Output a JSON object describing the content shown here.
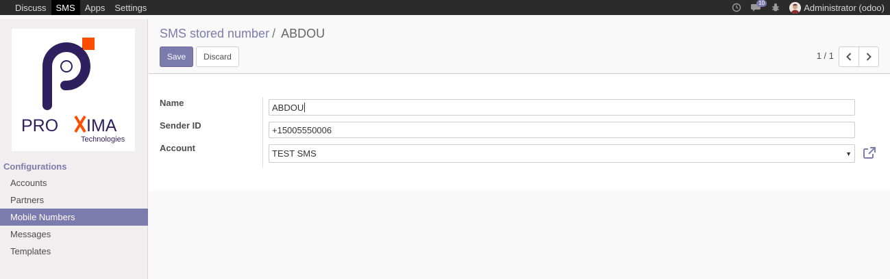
{
  "topbar": {
    "menu": [
      "Discuss",
      "SMS",
      "Apps",
      "Settings"
    ],
    "active_menu": "SMS",
    "chat_badge": "10",
    "user_label": "Administrator (odoo)"
  },
  "sidebar": {
    "logo_brand": "PROXIMA",
    "logo_sub": "Technologies",
    "section_title": "Configurations",
    "items": [
      {
        "label": "Accounts"
      },
      {
        "label": "Partners"
      },
      {
        "label": "Mobile Numbers"
      },
      {
        "label": "Messages"
      },
      {
        "label": "Templates"
      }
    ],
    "active_item": "Mobile Numbers"
  },
  "control": {
    "breadcrumb_parent": "SMS stored number",
    "breadcrumb_sep": "/",
    "breadcrumb_current": "ABDOU",
    "save_label": "Save",
    "discard_label": "Discard",
    "pager_text": "1 / 1"
  },
  "form": {
    "name_label": "Name",
    "name_value": "ABDOU",
    "sender_label": "Sender ID",
    "sender_value": "+15005550006",
    "account_label": "Account",
    "account_value": "TEST SMS"
  },
  "colors": {
    "accent": "#7c7bad",
    "topbar_bg": "#2b2b2b",
    "logo_purple": "#2e1f5e",
    "logo_orange": "#ff4d00"
  }
}
